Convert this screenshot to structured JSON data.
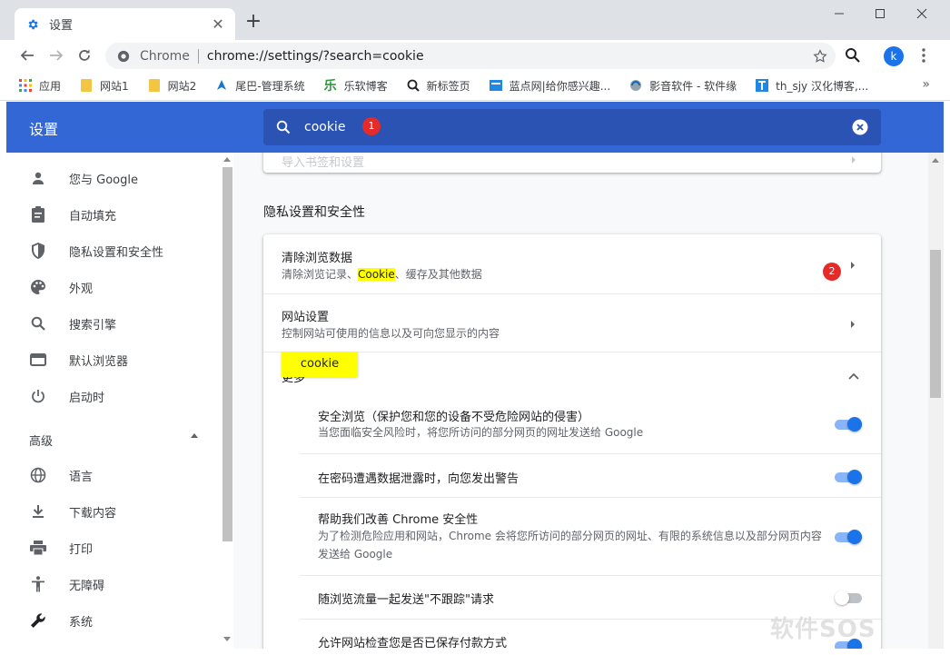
{
  "tab": {
    "title": "设置",
    "icon": "gear-icon"
  },
  "window": {
    "controls": [
      "minimize-icon",
      "maximize-icon",
      "close-icon"
    ]
  },
  "toolbar": {
    "chip": "Chrome",
    "url": "chrome://settings/?search=cookie",
    "avatar": "k"
  },
  "bookmarks": [
    {
      "label": "应用",
      "icon": "apps-grid-icon"
    },
    {
      "label": "网站1",
      "icon": "folder-icon"
    },
    {
      "label": "网站2",
      "icon": "folder-icon"
    },
    {
      "label": "尾巴-管理系统",
      "icon": "site-icon"
    },
    {
      "label": "乐软博客",
      "icon": "site-icon"
    },
    {
      "label": "新标签页",
      "icon": "search-icon"
    },
    {
      "label": "蓝点网|给你感兴趣...",
      "icon": "site-icon"
    },
    {
      "label": "影音软件 - 软件缘",
      "icon": "site-icon"
    },
    {
      "label": "th_sjy 汉化博客,...",
      "icon": "site-icon"
    }
  ],
  "header": {
    "title": "设置",
    "search_value": "cookie",
    "badge1": "1",
    "accent": "#3367d6"
  },
  "sidebar": {
    "items": [
      {
        "label": "您与 Google",
        "icon": "person-icon"
      },
      {
        "label": "自动填充",
        "icon": "clipboard-icon"
      },
      {
        "label": "隐私设置和安全性",
        "icon": "shield-icon"
      },
      {
        "label": "外观",
        "icon": "palette-icon"
      },
      {
        "label": "搜索引擎",
        "icon": "search-icon"
      },
      {
        "label": "默认浏览器",
        "icon": "browser-icon"
      },
      {
        "label": "启动时",
        "icon": "power-icon"
      }
    ],
    "advanced_label": "高级",
    "advanced_items": [
      {
        "label": "语言",
        "icon": "globe-icon"
      },
      {
        "label": "下载内容",
        "icon": "download-icon"
      },
      {
        "label": "打印",
        "icon": "printer-icon"
      },
      {
        "label": "无障碍",
        "icon": "accessibility-icon"
      },
      {
        "label": "系统",
        "icon": "wrench-icon"
      }
    ]
  },
  "main": {
    "top_card_ghost": "导入书签和设置",
    "section_title": "隐私设置和安全性",
    "clear": {
      "title": "清除浏览数据",
      "sub_before": "清除浏览记录、",
      "sub_highlight": "Cookie",
      "sub_after": "、缓存及其他数据",
      "badge2": "2"
    },
    "site": {
      "title": "网站设置",
      "sub": "控制网站可使用的信息以及可向您显示的内容"
    },
    "more_label": "更多",
    "tooltip": "cookie",
    "subrows": [
      {
        "title": "安全浏览（保护您和您的设备不受危险网站的侵害）",
        "sub": "当您面临安全风险时，将您所访问的部分网页的网址发送给 Google",
        "on": true
      },
      {
        "title": "在密码遭遇数据泄露时，向您发出警告",
        "sub": "",
        "on": true
      },
      {
        "title": "帮助我们改善 Chrome 安全性",
        "sub": "为了检测危险应用和网站，Chrome 会将您所访问的部分网页的网址、有限的系统信息以及部分网页内容发送给 Google",
        "on": true
      },
      {
        "title": "随浏览流量一起发送\"不跟踪\"请求",
        "sub": "",
        "on": false
      },
      {
        "title": "允许网站检查您是否已保存付款方式",
        "sub": "",
        "on": true
      }
    ]
  },
  "watermark": "软件SOS"
}
